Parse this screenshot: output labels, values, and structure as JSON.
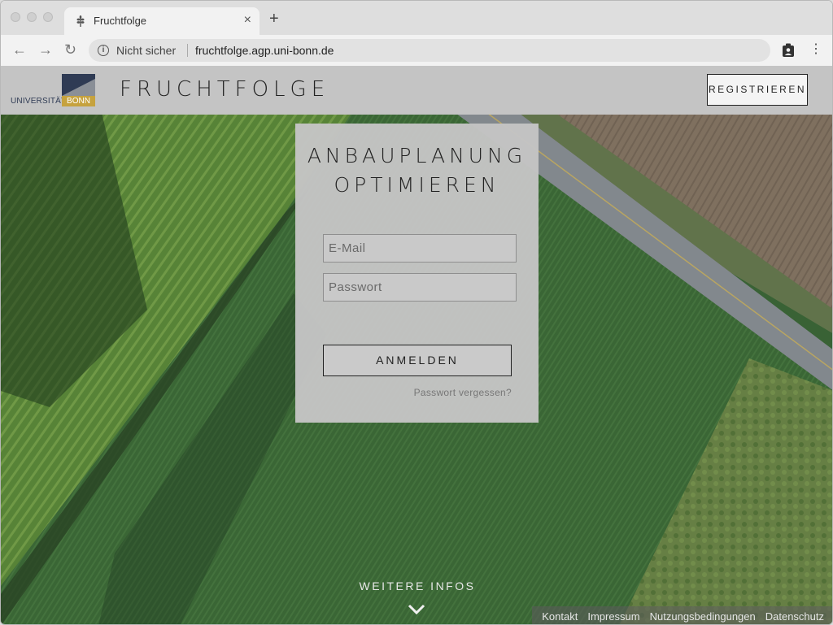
{
  "browser": {
    "tab_title": "Fruchtfolge",
    "security_label": "Nicht sicher",
    "url": "fruchtfolge.agp.uni-bonn.de",
    "icons": [
      "back-arrow-icon",
      "forward-arrow-icon",
      "reload-icon",
      "info-icon",
      "extension-icon",
      "menu-dots-icon"
    ]
  },
  "header": {
    "logo_word1": "UNIVERSITÄT",
    "logo_word2": "BONN",
    "site_title": "FRUCHTFOLGE",
    "register_label": "REGISTRIEREN"
  },
  "login": {
    "headline_line1": "ANBAUPLANUNG",
    "headline_line2": "OPTIMIEREN",
    "email_placeholder": "E-Mail",
    "password_placeholder": "Passwort",
    "submit_label": "ANMELDEN",
    "forgot_label": "Passwort vergessen?"
  },
  "more_info_label": "WEITERE INFOS",
  "footer": {
    "links": [
      "Kontakt",
      "Impressum",
      "Nutzungsbedingungen",
      "Datenschutz"
    ]
  },
  "colors": {
    "header_bg": "#c4c4c4",
    "card_bg": "#c4c4c4",
    "logo_blue": "#2f3b54",
    "logo_gold": "#c6a23e",
    "field_green": "#3d6e3a"
  }
}
